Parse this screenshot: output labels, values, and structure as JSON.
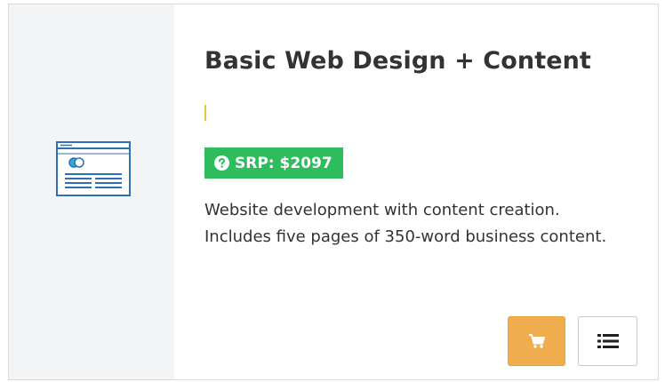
{
  "product": {
    "title": "Basic Web Design + Content",
    "srp": "SRP: $2097",
    "description": "Website development with content creation. Includes five pages of 350-word business content.",
    "icon": "website-layout-icon"
  },
  "actions": {
    "cart_icon": "shopping-cart-icon",
    "details_icon": "list-icon"
  },
  "colors": {
    "side_panel": "#f3f4f5",
    "badge": "#2dbd5c",
    "cart_button": "#f0ad4e",
    "icon_stroke": "#2f6fb5",
    "text": "#333333"
  }
}
